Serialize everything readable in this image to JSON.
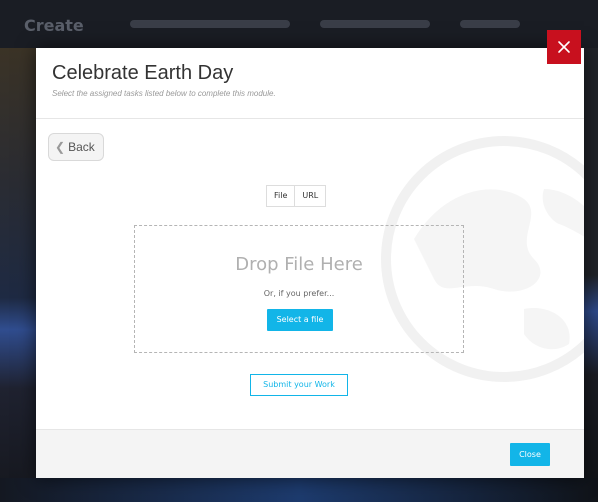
{
  "modal": {
    "title": "Celebrate Earth Day",
    "subtitle": "Select the assigned tasks listed below to complete this module."
  },
  "back_button": {
    "label": "Back",
    "icon": "chevron-left-icon"
  },
  "upload_tabs": [
    {
      "label": "File",
      "selected": true
    },
    {
      "label": "URL",
      "selected": false
    }
  ],
  "dropzone": {
    "title": "Drop File Here",
    "alt_text": "Or, if you prefer...",
    "select_label": "Select a file"
  },
  "submit_label": "Submit your Work",
  "footer": {
    "close_label": "Close"
  },
  "background": {
    "brand": "Create"
  },
  "colors": {
    "accent": "#12b5e8",
    "close_x_bg": "#c8101e"
  },
  "icons": {
    "modal_close": "close-icon",
    "watermark": "globe-icon"
  }
}
